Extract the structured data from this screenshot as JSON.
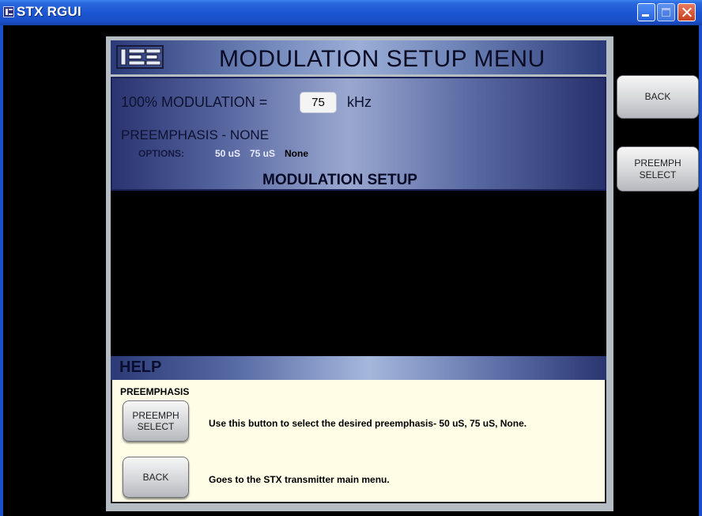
{
  "window": {
    "title": "STX RGUI",
    "icons": {
      "app": "be-logo-icon",
      "minimize": "minimize-icon",
      "maximize": "maximize-icon",
      "close": "close-icon"
    }
  },
  "header": {
    "logo": "BE",
    "title": "MODULATION SETUP MENU"
  },
  "setup": {
    "modulation_label": "100% MODULATION =",
    "modulation_value": "75",
    "modulation_unit": "kHz",
    "preemphasis_status": "PREEMPHASIS - NONE",
    "options_label": "OPTIONS:",
    "options": [
      {
        "label": "50 uS",
        "selected": false
      },
      {
        "label": "75 uS",
        "selected": false
      },
      {
        "label": "None",
        "selected": true
      }
    ],
    "section_title": "MODULATION SETUP"
  },
  "side_buttons": {
    "back": "BACK",
    "preemph_select": "PREEMPH\nSELECT"
  },
  "help": {
    "title": "HELP",
    "subtitle": "PREEMPHASIS",
    "items": [
      {
        "button": "PREEMPH\nSELECT",
        "text": "Use this button to select the desired preemphasis- 50 uS, 75 uS, None."
      },
      {
        "button": "BACK",
        "text": "Goes to the STX transmitter main menu."
      }
    ]
  },
  "colors": {
    "titlebar": "#1d56d2",
    "panel": "#b6bcc3",
    "help_background": "#fffde6",
    "text_dark": "#0f1230"
  }
}
